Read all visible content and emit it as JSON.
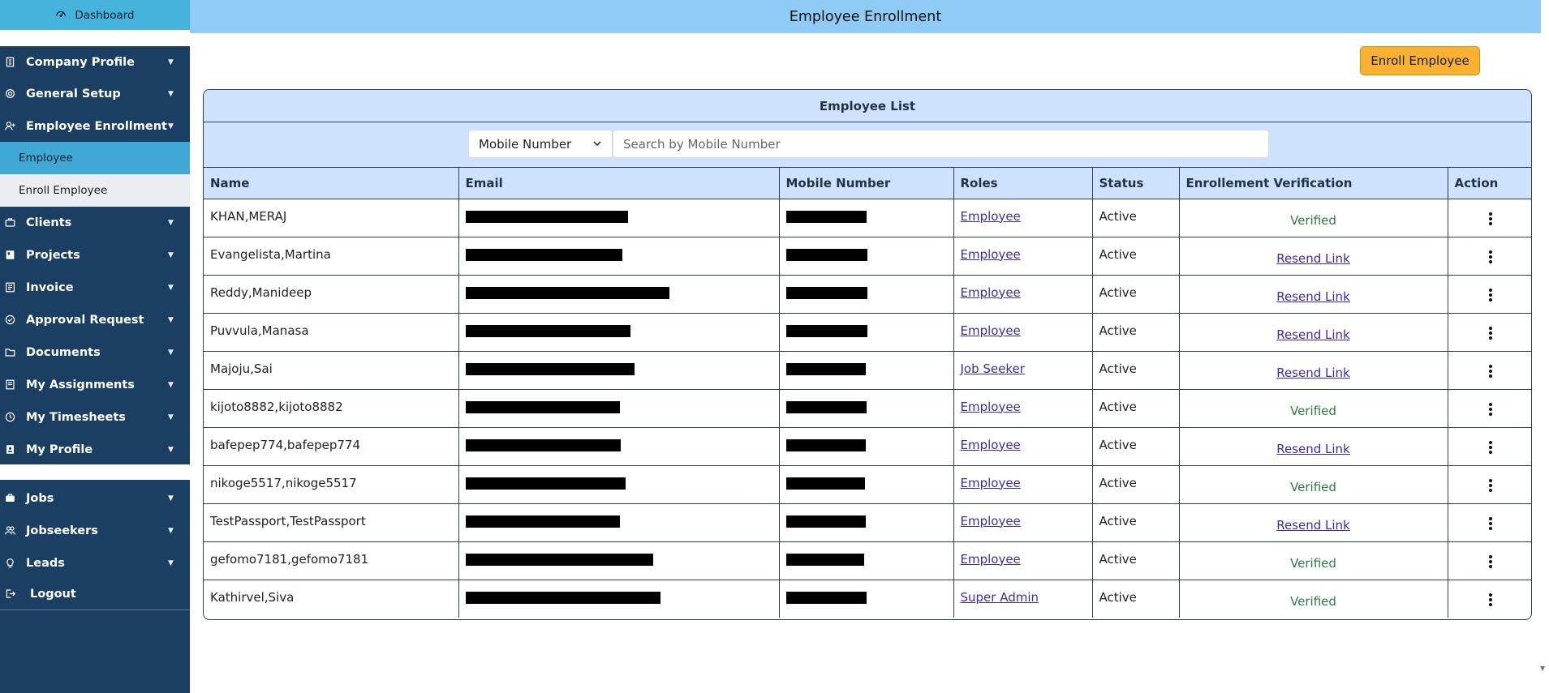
{
  "sidebar": {
    "dashboard": "Dashboard",
    "items_top": [
      {
        "label": "Company Profile",
        "icon": "building-icon"
      },
      {
        "label": "General Setup",
        "icon": "gear-icon"
      },
      {
        "label": "Employee Enrollment",
        "icon": "user-plus-icon"
      }
    ],
    "subitems": [
      {
        "label": "Employee",
        "active": true
      },
      {
        "label": "Enroll Employee",
        "active": false
      }
    ],
    "items_mid": [
      {
        "label": "Clients",
        "icon": "briefcase-icon"
      },
      {
        "label": "Projects",
        "icon": "project-icon"
      },
      {
        "label": "Invoice",
        "icon": "invoice-icon"
      },
      {
        "label": "Approval Request",
        "icon": "check-circle-icon"
      },
      {
        "label": "Documents",
        "icon": "folder-icon"
      },
      {
        "label": "My Assignments",
        "icon": "assignment-icon"
      },
      {
        "label": "My Timesheets",
        "icon": "clock-icon"
      },
      {
        "label": "My Profile",
        "icon": "id-card-icon"
      }
    ],
    "items_bottom": [
      {
        "label": "Jobs",
        "icon": "briefcase-icon"
      },
      {
        "label": "Jobseekers",
        "icon": "users-icon"
      },
      {
        "label": "Leads",
        "icon": "lightbulb-icon"
      }
    ],
    "logout": "Logout"
  },
  "header": {
    "title": "Employee Enrollment"
  },
  "enroll_button": "Enroll Employee",
  "card": {
    "title": "Employee List",
    "filter_select": "Mobile Number",
    "search_placeholder": "Search by Mobile Number"
  },
  "table": {
    "columns": [
      "Name",
      "Email",
      "Mobile Number",
      "Roles",
      "Status",
      "Enrollement Verification",
      "Action"
    ],
    "rows": [
      {
        "name": "KHAN,MERAJ",
        "role": "Employee",
        "status": "Active",
        "verification": "Verified"
      },
      {
        "name": "Evangelista,Martina",
        "role": "Employee",
        "status": "Active",
        "verification": "Resend Link"
      },
      {
        "name": "Reddy,Manideep",
        "role": "Employee",
        "status": "Active",
        "verification": "Resend Link"
      },
      {
        "name": "Puvvula,Manasa",
        "role": "Employee",
        "status": "Active",
        "verification": "Resend Link"
      },
      {
        "name": "Majoju,Sai",
        "role": "Job Seeker",
        "status": "Active",
        "verification": "Resend Link"
      },
      {
        "name": "kijoto8882,kijoto8882",
        "role": "Employee",
        "status": "Active",
        "verification": "Verified"
      },
      {
        "name": "bafepep774,bafepep774",
        "role": "Employee",
        "status": "Active",
        "verification": "Resend Link"
      },
      {
        "name": "nikoge5517,nikoge5517",
        "role": "Employee",
        "status": "Active",
        "verification": "Verified"
      },
      {
        "name": "TestPassport,TestPassport",
        "role": "Employee",
        "status": "Active",
        "verification": "Resend Link"
      },
      {
        "name": "gefomo7181,gefomo7181",
        "role": "Employee",
        "status": "Active",
        "verification": "Verified"
      },
      {
        "name": "Kathirvel,Siva",
        "role": "Super Admin",
        "status": "Active",
        "verification": "Verified"
      }
    ]
  },
  "colors": {
    "sidebar_bg": "#1b3f63",
    "header_bg": "#8fcbf5",
    "accent_button": "#f8b132",
    "card_header_bg": "#cfe2fd",
    "verified_green": "#2d7a43",
    "link_purple": "#3b2bb0"
  }
}
